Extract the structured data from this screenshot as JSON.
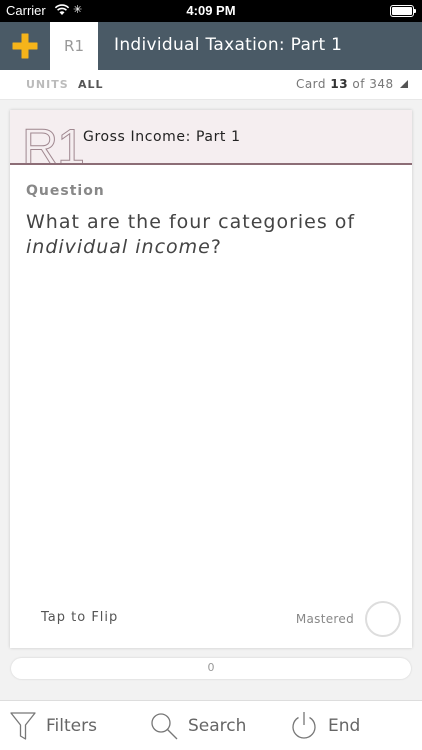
{
  "status_bar": {
    "carrier": "Carrier",
    "time": "4:09 PM"
  },
  "nav": {
    "unit_tab": "R1",
    "title": "Individual Taxation: Part 1"
  },
  "units_bar": {
    "units_label": "UNITS",
    "filter_value": "ALL",
    "card_prefix": "Card",
    "card_current": "13",
    "card_of": "of 348"
  },
  "card": {
    "unit_code": "R1",
    "title": "Gross Income: Part 1",
    "section_label": "Question",
    "question_part1": "What are the four categories of",
    "question_italic": "individual income",
    "question_end": "?",
    "tap_to_flip": "Tap to Flip",
    "mastered_label": "Mastered"
  },
  "progress": {
    "value": "0",
    "fraction": 0
  },
  "toolbar": {
    "filters_label": "Filters",
    "search_label": "Search",
    "end_label": "End"
  },
  "colors": {
    "accent": "#f6b41a",
    "nav_bg": "#4a5a66",
    "card_header_bg": "#f5eef0",
    "card_header_border": "#8c6d76"
  },
  "icons": {
    "add": "plus-icon",
    "filters": "funnel-icon",
    "search": "magnifier-icon",
    "end": "power-icon"
  }
}
